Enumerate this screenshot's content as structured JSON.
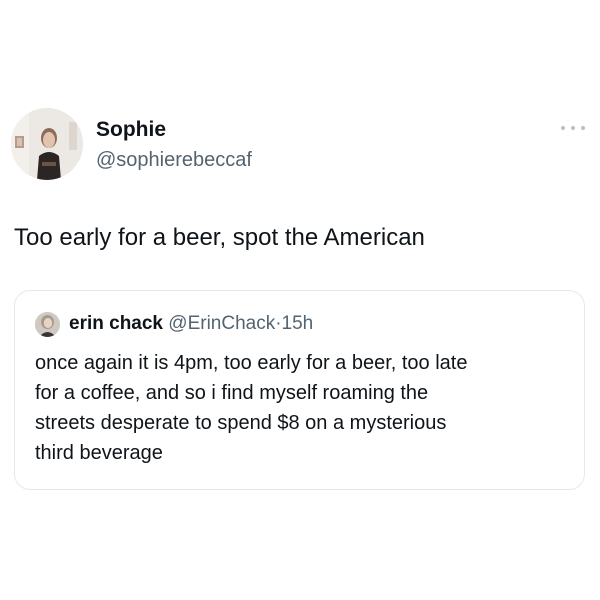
{
  "tweet": {
    "author": {
      "name": "Sophie",
      "handle": "@sophierebeccaf",
      "avatar_icon": "profile-photo"
    },
    "more_icon": "more-horizontal-icon",
    "text": "Too early for a beer, spot the American",
    "quote": {
      "author": {
        "name": "erin chack",
        "handle": "@ErinChack",
        "separator": "·",
        "time": "15h",
        "avatar_icon": "profile-photo"
      },
      "lines": [
        "once again it is 4pm, too early for a beer, too late",
        "for a coffee, and so i find myself roaming the",
        "streets desperate to spend $8 on a mysterious",
        "third beverage"
      ]
    }
  },
  "colors": {
    "text_primary": "#0f1419",
    "text_secondary": "#536471",
    "card_border": "#e6e9ec",
    "background": "#ffffff"
  }
}
